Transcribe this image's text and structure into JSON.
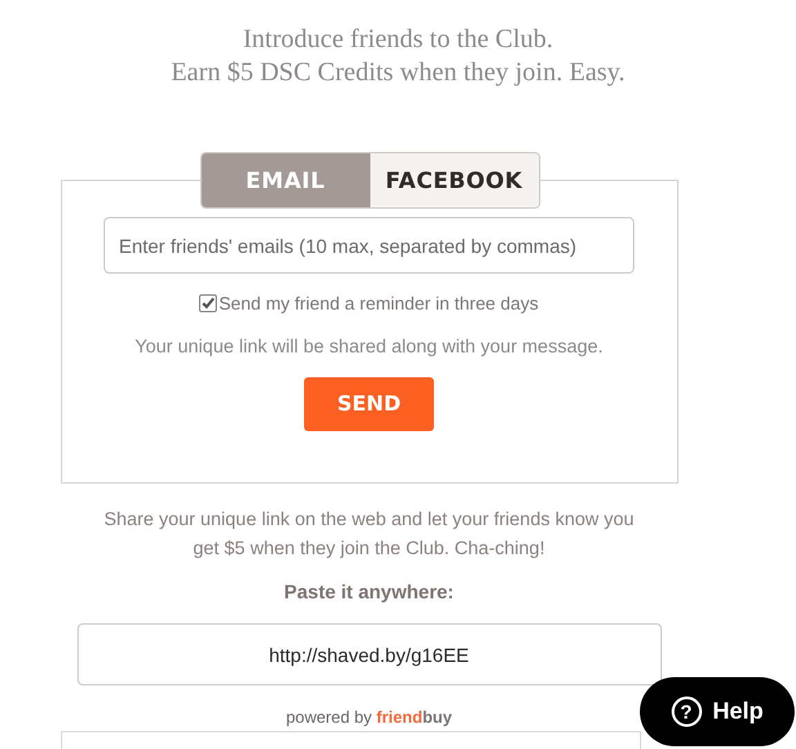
{
  "headline": [
    "Introduce friends to the Club.",
    "Earn $5 DSC Credits when they join. Easy."
  ],
  "tabs": [
    {
      "label": "EMAIL",
      "selected": true
    },
    {
      "label": "FACEBOOK",
      "selected": false
    }
  ],
  "email_form": {
    "placeholder": "Enter friends' emails (10 max, separated by commas)",
    "reminder": {
      "label": "Send my friend a reminder in three days",
      "checked": true
    },
    "note": "Your unique link will be shared along with your message.",
    "button": "SEND"
  },
  "share": {
    "text": "Share your unique link on the web and let your friends know you get $5 when they join the Club. Cha-ching!",
    "label": "Paste it anywhere:",
    "link": "http://shaved.by/g16EE"
  },
  "powered_by": {
    "text": "powered by",
    "brand_first": "friend",
    "brand_second": "buy"
  },
  "help_button": {
    "label": "Help",
    "icon": "?"
  }
}
